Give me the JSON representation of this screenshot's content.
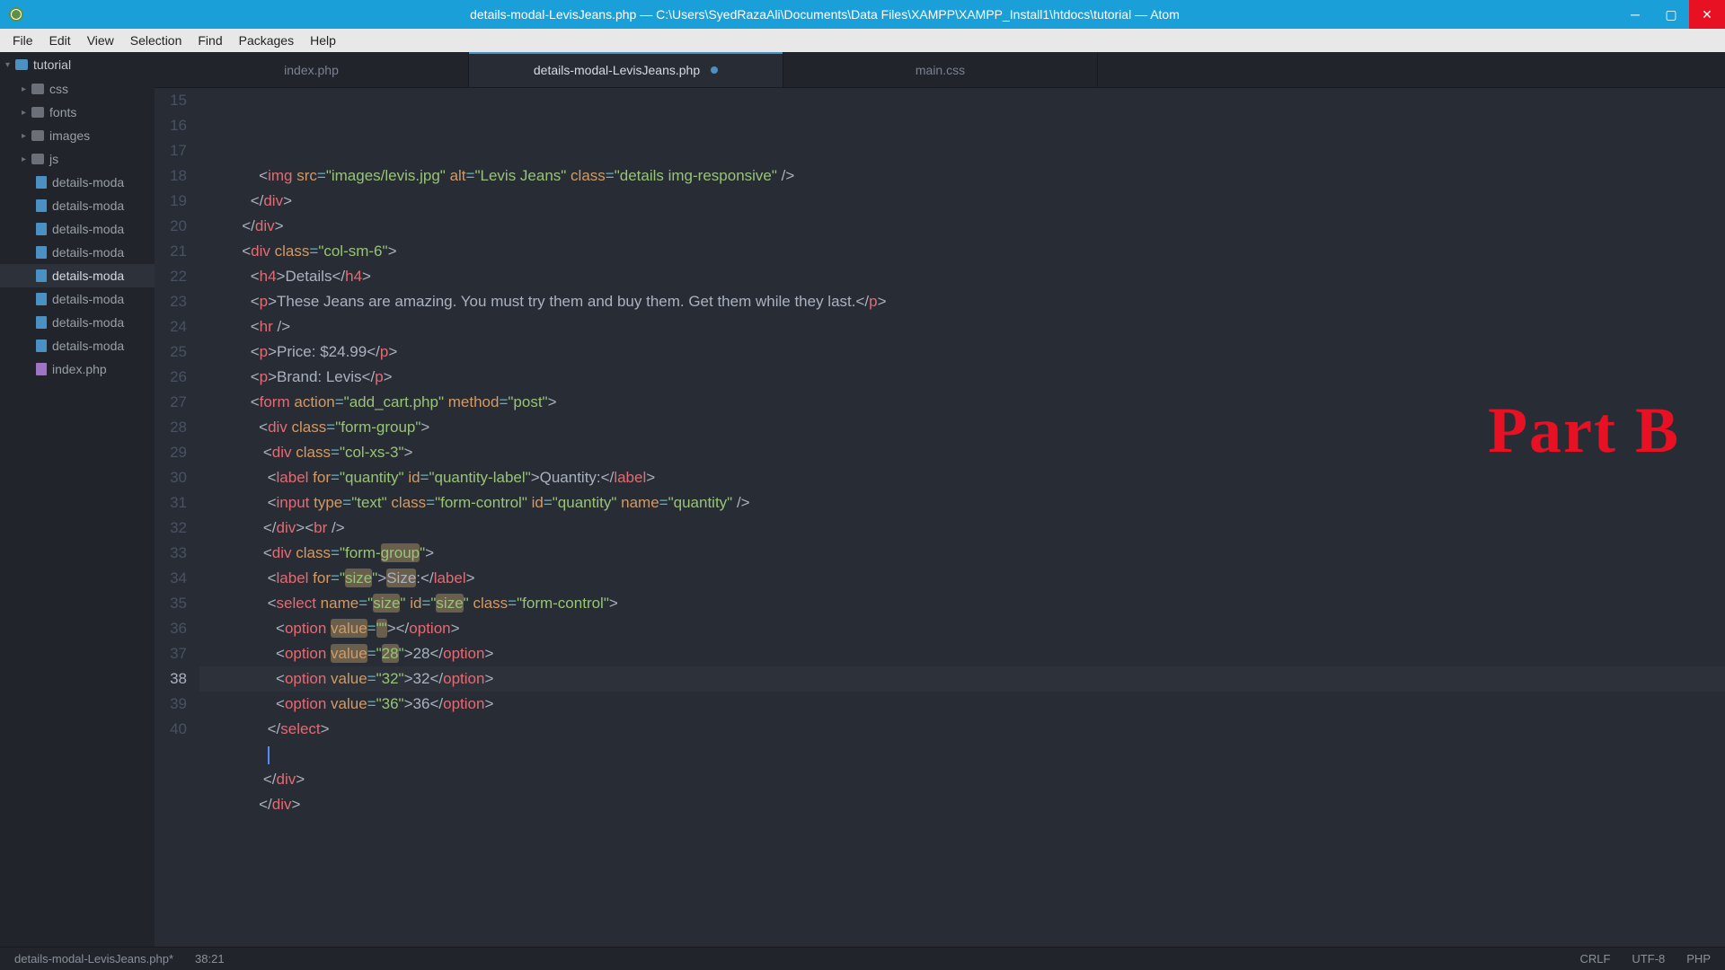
{
  "titlebar": {
    "title": "details-modal-LevisJeans.php — C:\\Users\\SyedRazaAli\\Documents\\Data Files\\XAMPP\\XAMPP_Install1\\htdocs\\tutorial — Atom"
  },
  "menu": {
    "items": [
      "File",
      "Edit",
      "View",
      "Selection",
      "Find",
      "Packages",
      "Help"
    ]
  },
  "sidebar": {
    "root": "tutorial",
    "folders": [
      "css",
      "fonts",
      "images",
      "js"
    ],
    "files": [
      "details-moda",
      "details-moda",
      "details-moda",
      "details-moda",
      "details-moda",
      "details-moda",
      "details-moda",
      "details-moda",
      "index.php"
    ],
    "activeIndex": 4
  },
  "tabs": {
    "items": [
      "index.php",
      "details-modal-LevisJeans.php",
      "main.css"
    ],
    "activeIndex": 1,
    "dirtyIndex": 1
  },
  "gutter": {
    "start": 15,
    "count": 26,
    "activeLine": 38
  },
  "code": {
    "img_tag": "img",
    "img_src_attr": "src",
    "img_src_val": "\"images/levis.jpg\"",
    "img_alt_attr": "alt",
    "img_alt_val": "\"Levis Jeans\"",
    "img_class_attr": "class",
    "img_class_val": "\"details img-responsive\"",
    "div_tag": "div",
    "close_div": "/div",
    "class_attr": "class",
    "col_sm6": "\"col-sm-6\"",
    "col_xs3": "\"col-xs-3\"",
    "fg": "\"form-group\"",
    "h4_tag": "h4",
    "close_h4": "/h4",
    "details_txt": "Details",
    "p_tag": "p",
    "close_p": "/p",
    "desc_txt": "These Jeans are amazing. You must try them and buy them. Get them while they last.",
    "hr_tag": "hr",
    "price_txt": "Price: $24.99",
    "brand_txt": "Brand: Levis",
    "form_tag": "form",
    "action_attr": "action",
    "action_val": "\"add_cart.php\"",
    "method_attr": "method",
    "method_val": "\"post\"",
    "label_tag": "label",
    "close_label": "/label",
    "for_attr": "for",
    "qty_for_val": "\"quantity\"",
    "id_attr": "id",
    "qty_lbl_id": "\"quantity-label\"",
    "qty_lbl_txt": "Quantity:",
    "input_tag": "input",
    "type_attr": "type",
    "type_text": "\"text\"",
    "fc": "\"form-control\"",
    "qty_id": "\"quantity\"",
    "name_attr": "name",
    "qty_name": "\"quantity\"",
    "br_tag": "br",
    "size_for": "\"size\"",
    "size_lbl": "Size:",
    "select_tag": "select",
    "close_select": "/select",
    "size_name": "\"size\"",
    "size_id": "\"size\"",
    "option_tag": "option",
    "close_option": "/option",
    "value_attr": "value",
    "opt_empty": "\"\"",
    "opt_28": "\"28\"",
    "opt_32": "\"32\"",
    "opt_36": "\"36\"",
    "txt_28": "28",
    "txt_32": "32",
    "txt_36": "36"
  },
  "watermark": "Part B",
  "statusbar": {
    "filename": "details-modal-LevisJeans.php*",
    "cursor": "38:21",
    "lineending": "CRLF",
    "encoding": "UTF-8",
    "grammar": "PHP"
  }
}
